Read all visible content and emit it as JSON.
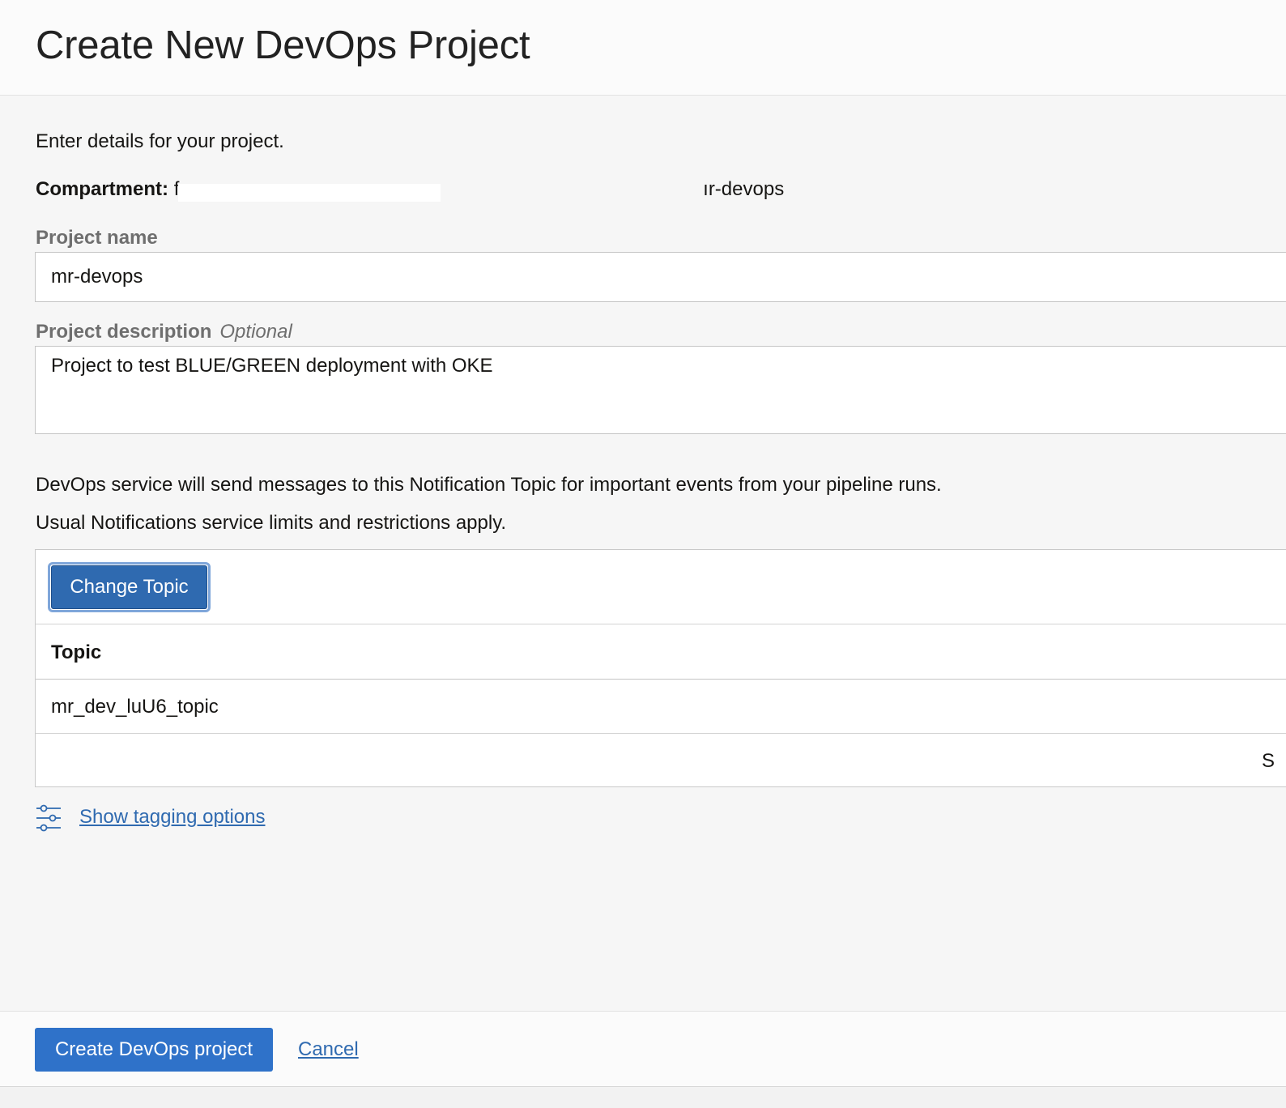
{
  "header": {
    "title": "Create New DevOps Project"
  },
  "form": {
    "intro": "Enter details for your project.",
    "compartment_label": "Compartment:",
    "compartment_value": "f                                                                                                 ır-devops",
    "project_name_label": "Project name",
    "project_name_value": "mr-devops",
    "project_description_label": "Project description",
    "project_description_optional": "Optional",
    "project_description_value": "Project to test BLUE/GREEN deployment with OKE"
  },
  "notifications": {
    "line1": "DevOps service will send messages to this Notification Topic for important events from your pipeline runs.",
    "line2": "Usual Notifications service limits and restrictions apply.",
    "change_topic_label": "Change Topic",
    "column_header": "Topic",
    "rows": [
      "mr_dev_luU6_topic"
    ],
    "footer_cut_text": "S"
  },
  "tagging": {
    "link_label": "Show tagging options",
    "icon": "sliders-icon"
  },
  "footer": {
    "create_label": "Create DevOps project",
    "cancel_label": "Cancel"
  },
  "colors": {
    "accent": "#2f72c9",
    "link": "#2f6ab0",
    "focus_ring": "#7fa6da"
  }
}
